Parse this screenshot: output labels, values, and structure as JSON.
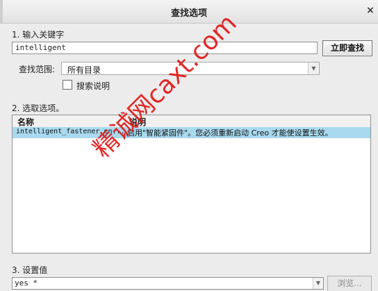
{
  "dialog": {
    "title": "查找选项",
    "close_glyph": "×"
  },
  "step1": {
    "label": "1.  输入关键字",
    "keyword_value": "intelligent",
    "search_button": "立即查找",
    "scope_label": "查找范围:",
    "scope_value": "所有目录",
    "search_desc_label": "搜索说明"
  },
  "step2": {
    "label": "2.  选取选项。",
    "columns": {
      "name": "名称",
      "desc": "说明"
    },
    "rows": [
      {
        "name": "intelligent_fastener_en...",
        "desc": "启用\"智能紧固件\"。您必须重新启动 Creo 才能使设置生效。",
        "selected": true
      }
    ]
  },
  "step3": {
    "label": "3.  设置值",
    "value": "yes *",
    "browse_button": "浏览..."
  },
  "watermark": "精诚网caxt.com",
  "colors": {
    "selection": "#a9d9ef",
    "watermark": "#e01818"
  }
}
